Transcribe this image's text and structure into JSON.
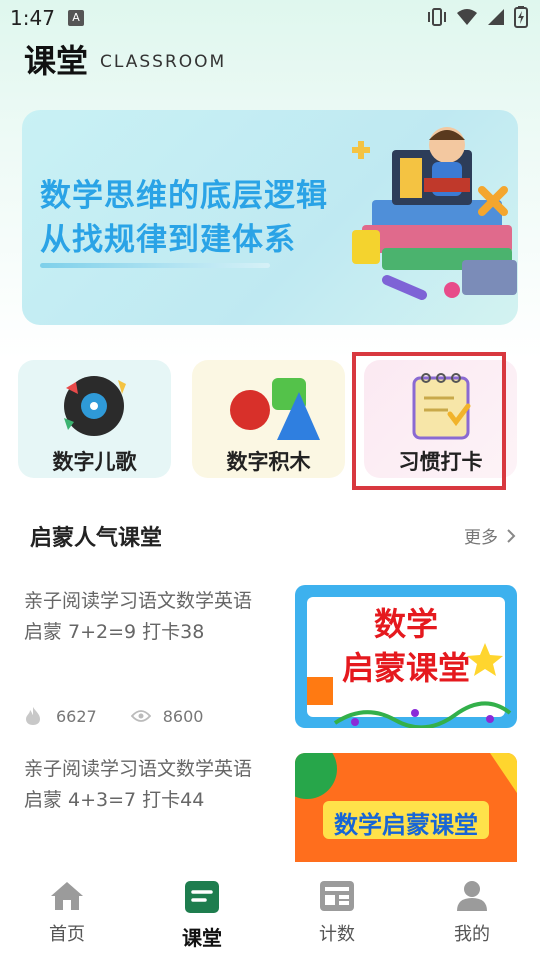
{
  "status_bar": {
    "time": "1:47",
    "notif_badge": "A"
  },
  "header": {
    "title": "课堂",
    "subtitle": "CLASSROOM"
  },
  "banner": {
    "line1": "数学思维的底层逻辑",
    "line2": "从找规律到建体系"
  },
  "categories": [
    {
      "label": "数字儿歌",
      "icon": "music-record-icon"
    },
    {
      "label": "数字积木",
      "icon": "geometric-blocks-icon"
    },
    {
      "label": "习惯打卡",
      "icon": "checklist-notepad-icon",
      "highlighted": true
    }
  ],
  "section": {
    "title": "启蒙人气课堂",
    "more": "更多"
  },
  "courses": [
    {
      "title": "亲子阅读学习语文数学英语启蒙 7+2=9 打卡38",
      "likes": "6627",
      "views": "8600",
      "thumb_text_1": "数学",
      "thumb_text_2": "启蒙课堂"
    },
    {
      "title": "亲子阅读学习语文数学英语启蒙 4+3=7 打卡44",
      "thumb_text": "数学启蒙课堂"
    }
  ],
  "nav": [
    {
      "label": "首页",
      "icon": "home-icon"
    },
    {
      "label": "课堂",
      "icon": "classroom-book-icon",
      "active": true
    },
    {
      "label": "计数",
      "icon": "counter-board-icon"
    },
    {
      "label": "我的",
      "icon": "user-icon"
    }
  ],
  "colors": {
    "accent": "#1e7d4e",
    "banner_text": "#2aa3e6",
    "highlight": "#d8383f"
  }
}
